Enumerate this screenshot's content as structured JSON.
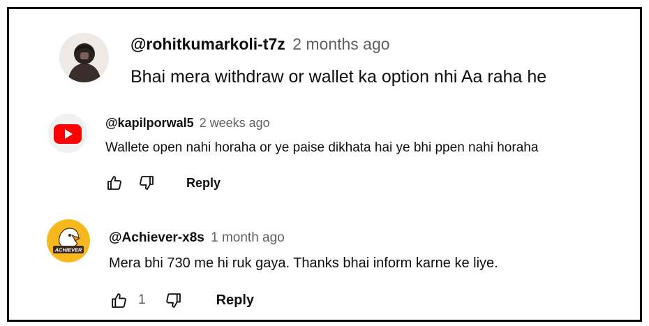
{
  "comments": [
    {
      "author": "@rohitkumarkoli-t7z",
      "time": "2 months ago",
      "text": "Bhai mera withdraw or wallet ka option nhi Aa raha he",
      "avatar_icon": "user-photo-avatar"
    },
    {
      "author": "@kapilporwal5",
      "time": "2 weeks ago",
      "text": "Wallete open nahi horaha or ye paise dikhata hai ye bhi ppen nahi horaha",
      "avatar_icon": "youtube-logo-icon",
      "reply_label": "Reply",
      "accent": "#ff0000"
    },
    {
      "author": "@Achiever-x8s",
      "time": "1 month ago",
      "text": "Mera bhi 730 me hi ruk gaya. Thanks bhai inform karne ke liye.",
      "avatar_icon": "eagle-achiever-avatar",
      "avatar_text": "ACHIEVER",
      "like_count": "1",
      "reply_label": "Reply",
      "accent": "#f6b81c"
    }
  ]
}
